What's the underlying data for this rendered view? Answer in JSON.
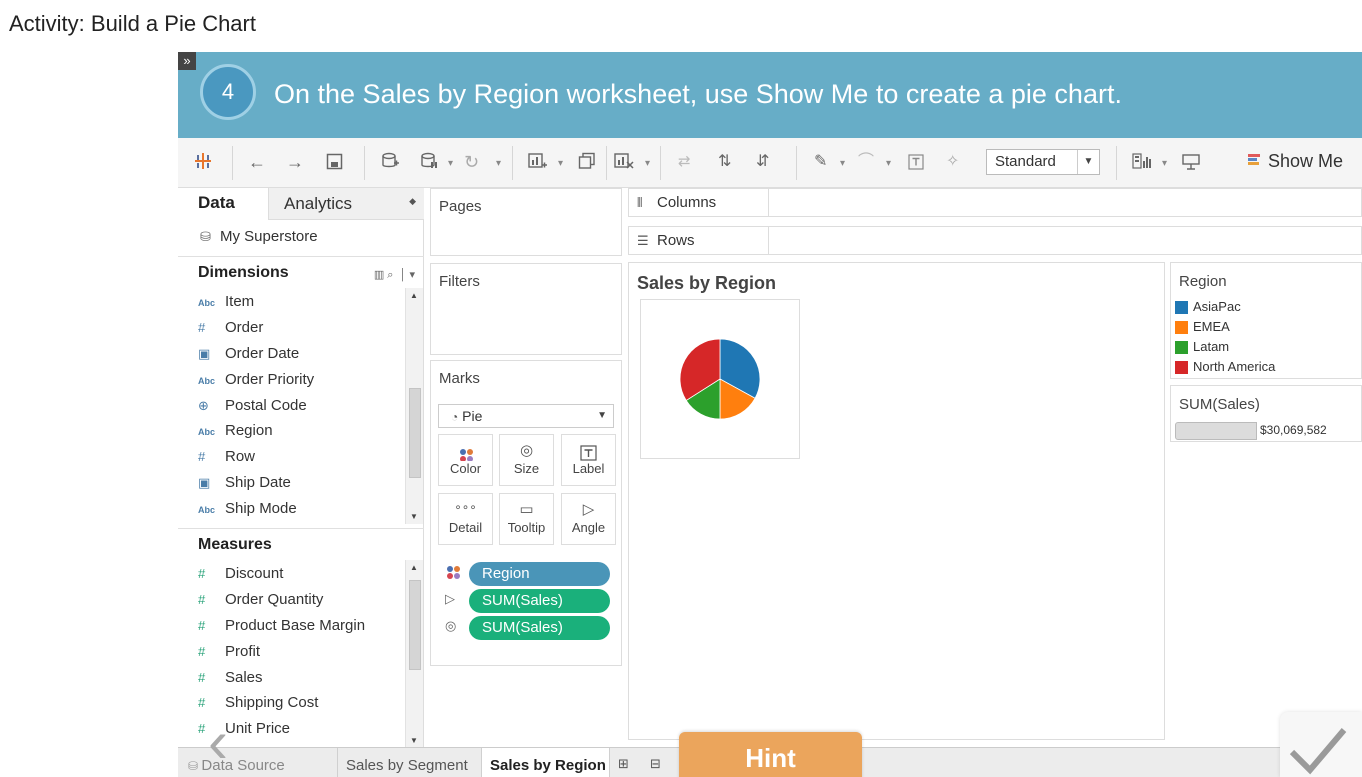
{
  "activity_title": "Activity: Build a Pie Chart",
  "expand_glyph": "»",
  "step": {
    "number": "4",
    "text": "On the Sales by Region worksheet, use Show Me to create a pie chart."
  },
  "toolbar": {
    "fit": "Standard",
    "show_me": "Show Me"
  },
  "data_pane": {
    "tab_data": "Data",
    "tab_analytics": "Analytics",
    "datasource": "My Superstore",
    "dimensions_label": "Dimensions",
    "dimensions": [
      {
        "type": "Abc",
        "name": "Item"
      },
      {
        "type": "#",
        "name": "Order"
      },
      {
        "type": "date",
        "name": "Order Date"
      },
      {
        "type": "Abc",
        "name": "Order Priority"
      },
      {
        "type": "geo",
        "name": "Postal Code"
      },
      {
        "type": "Abc",
        "name": "Region"
      },
      {
        "type": "#",
        "name": "Row"
      },
      {
        "type": "date",
        "name": "Ship Date"
      },
      {
        "type": "Abc",
        "name": "Ship Mode"
      }
    ],
    "measures_label": "Measures",
    "measures": [
      "Discount",
      "Order Quantity",
      "Product Base Margin",
      "Profit",
      "Sales",
      "Shipping Cost",
      "Unit Price"
    ]
  },
  "shelves": {
    "pages": "Pages",
    "filters": "Filters",
    "columns": "Columns",
    "rows": "Rows"
  },
  "marks": {
    "title": "Marks",
    "type": "Pie",
    "buttons": [
      {
        "label": "Color",
        "icon": "color-icon"
      },
      {
        "label": "Size",
        "icon": "size-icon"
      },
      {
        "label": "Label",
        "icon": "label-icon"
      },
      {
        "label": "Detail",
        "icon": "detail-icon"
      },
      {
        "label": "Tooltip",
        "icon": "tooltip-icon"
      },
      {
        "label": "Angle",
        "icon": "angle-icon"
      }
    ],
    "pills": [
      {
        "icon": "color-icon",
        "label": "Region",
        "color": "#4a95b8"
      },
      {
        "icon": "angle-icon",
        "label": "SUM(Sales)",
        "color": "#1ab07b"
      },
      {
        "icon": "size-icon",
        "label": "SUM(Sales)",
        "color": "#1ab07b"
      }
    ]
  },
  "view": {
    "title": "Sales by Region"
  },
  "legend": {
    "title": "Region",
    "items": [
      {
        "label": "AsiaPac",
        "color": "#1f77b4"
      },
      {
        "label": "EMEA",
        "color": "#ff7f0e"
      },
      {
        "label": "Latam",
        "color": "#2ca02c"
      },
      {
        "label": "North America",
        "color": "#d62728"
      }
    ]
  },
  "size_legend": {
    "title": "SUM(Sales)",
    "value": "$30,069,582"
  },
  "chart_data": {
    "type": "pie",
    "title": "Sales by Region",
    "categories": [
      "AsiaPac",
      "EMEA",
      "Latam",
      "North America"
    ],
    "values": [
      0.33,
      0.17,
      0.16,
      0.34
    ],
    "colors": [
      "#1f77b4",
      "#ff7f0e",
      "#2ca02c",
      "#d62728"
    ],
    "legend": "right"
  },
  "sheet_tabs": {
    "data_source": "Data Source",
    "tabs": [
      "Sales by Segment",
      "Sales by Region"
    ],
    "active": "Sales by Region"
  },
  "nav": {
    "hint": "Hint",
    "prev_glyph": "‹",
    "check_glyph": "✓"
  }
}
